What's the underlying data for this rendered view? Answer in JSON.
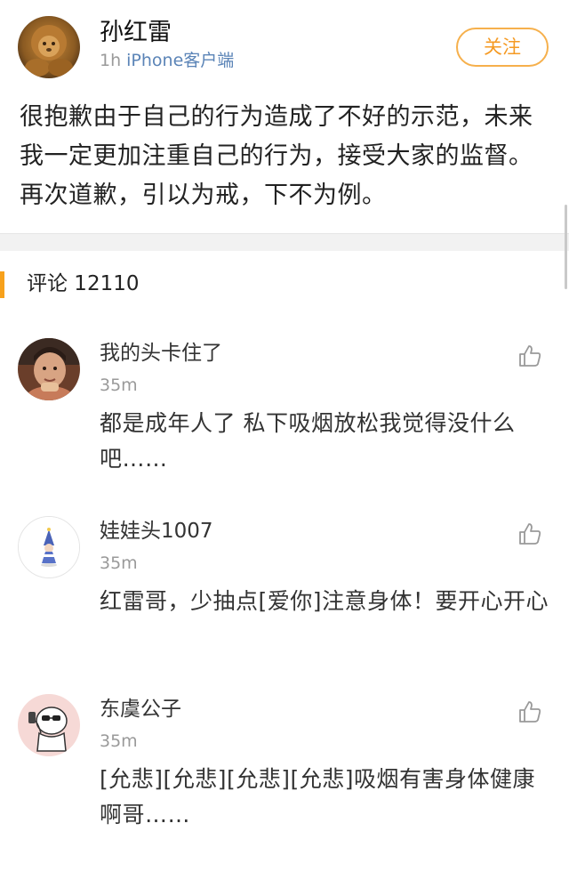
{
  "post": {
    "author": "孙红雷",
    "time": "1h",
    "source": "iPhone客户端",
    "follow_label": "关注",
    "content": "很抱歉由于自己的行为造成了不好的示范，未来我一定更加注重自己的行为，接受大家的监督。再次道歉，引以为戒，下不为例。",
    "avatar_icon": "lion-avatar"
  },
  "comments_section": {
    "label": "评论 12110",
    "accent_color": "#f7a11c"
  },
  "comments": [
    {
      "name": "我的头卡住了",
      "time": "35m",
      "text": "都是成年人了 私下吸烟放松我觉得没什么吧……",
      "avatar_icon": "person-avatar"
    },
    {
      "name": "娃娃头1007",
      "time": "35m",
      "text": "红雷哥，少抽点[爱你]注意身体！要开心开心",
      "avatar_icon": "wizard-doll-avatar"
    },
    {
      "name": "东虞公子",
      "time": "35m",
      "text": "[允悲][允悲][允悲][允悲]吸烟有害身体健康啊哥……",
      "avatar_icon": "cartoon-cat-avatar"
    }
  ],
  "colors": {
    "follow_accent": "#f59a23",
    "source_link": "#5b84b7",
    "meta_gray": "#9a9a9a"
  }
}
